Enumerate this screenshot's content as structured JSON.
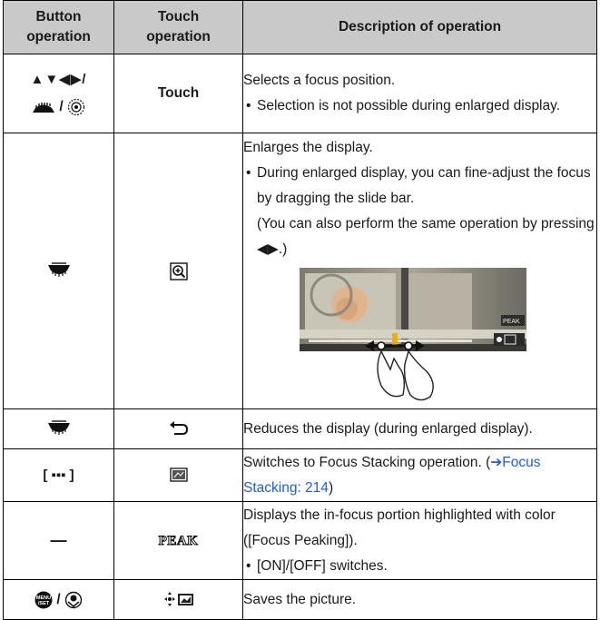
{
  "headers": {
    "button": "Button operation",
    "touch": "Touch operation",
    "description": "Description of operation"
  },
  "rows": [
    {
      "button_cursor": "▲▼◀▶/",
      "button_sep": "/",
      "button_icons": [
        "rear-dial-icon",
        "control-dial-icon"
      ],
      "touch": "Touch",
      "desc": "Selects a focus position.",
      "bullet": "Selection is not possible during enlarged display."
    },
    {
      "button_icons": [
        "rear-dial-icon"
      ],
      "touch_icon": "zoom-in-icon",
      "desc": "Enlarges the display.",
      "bullet": "During enlarged display, you can fine-adjust the focus by dragging the slide bar.",
      "note": "(You can also perform the same operation by pressing ◀▶.)",
      "illustration": "slide-bar-drag-illustration"
    },
    {
      "button_icons": [
        "rear-dial-icon"
      ],
      "touch_icon": "return-icon",
      "desc": "Reduces the display (during enlarged display)."
    },
    {
      "button_text": "[ ▪▪▪ ]",
      "touch_icon": "focus-stacking-icon",
      "desc": "Switches to Focus Stacking operation. (",
      "link_text": "➔Focus Stacking: 214",
      "desc_end": ")"
    },
    {
      "button_text": "—",
      "touch_icon": "peak-icon",
      "touch_icon_text": "PEAK",
      "desc": "Displays the in-focus portion highlighted with color ([Focus Peaking]).",
      "bullet": "[ON]/[OFF] switches."
    },
    {
      "button_sep": "/",
      "button_icons": [
        "menu-set-button-icon",
        "af-on-button-icon"
      ],
      "touch_icon": "playback-focus-icon",
      "desc": "Saves the picture."
    }
  ],
  "colors": {
    "header_bg": "#c9c9c9",
    "link": "#1f5fd1",
    "border": "#000000"
  }
}
